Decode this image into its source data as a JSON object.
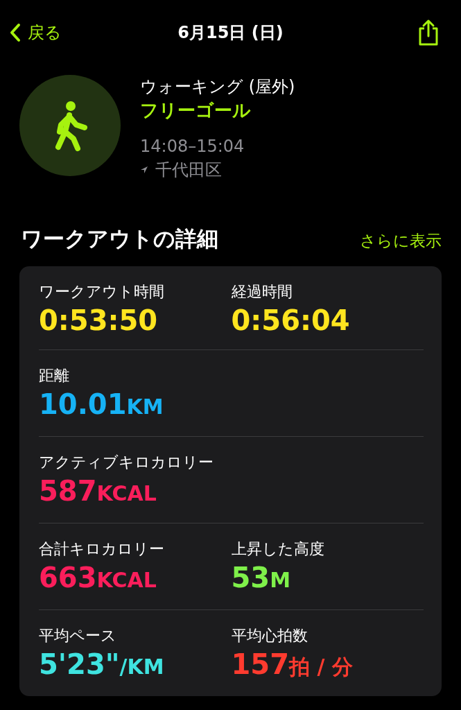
{
  "nav": {
    "back": "戻る",
    "title": "6月15日 (日)"
  },
  "workout": {
    "name": "ウォーキング (屋外)",
    "goal": "フリーゴール",
    "time": "14:08–15:04",
    "location": "千代田区"
  },
  "section": {
    "title": "ワークアウトの詳細",
    "more": "さらに表示"
  },
  "rows": [
    {
      "metrics": [
        {
          "label": "ワークアウト時間",
          "value": "0:53:50",
          "color": "#ffe51f"
        },
        {
          "label": "経過時間",
          "value": "0:56:04",
          "color": "#ffe51f"
        }
      ]
    },
    {
      "metrics": [
        {
          "label": "距離",
          "value": "10.01",
          "unit": "KM",
          "color": "#16b2f5"
        }
      ]
    },
    {
      "metrics": [
        {
          "label": "アクティブキロカロリー",
          "value": "587",
          "unit": "KCAL",
          "color": "#fa1e5b"
        }
      ]
    },
    {
      "metrics": [
        {
          "label": "合計キロカロリー",
          "value": "663",
          "unit": "KCAL",
          "color": "#fa1e5b"
        },
        {
          "label": "上昇した高度",
          "value": "53",
          "unit": "M",
          "color": "#7ff04a"
        }
      ]
    },
    {
      "metrics": [
        {
          "label": "平均ペース",
          "value": "5'23\"",
          "unit": "/KM",
          "color": "#3fe3e0"
        },
        {
          "label": "平均心拍数",
          "value": "157",
          "unit": "拍 / 分",
          "color": "#ff3b2f"
        }
      ]
    }
  ]
}
